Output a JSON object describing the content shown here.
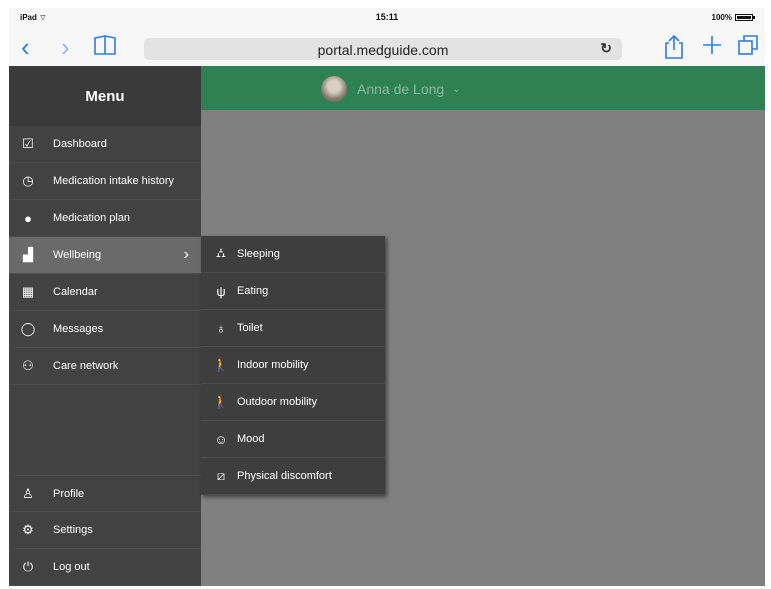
{
  "status_bar": {
    "device": "iPad",
    "time": "15:11",
    "battery": "100%"
  },
  "browser": {
    "url": "portal.medguide.com",
    "icons": [
      "back-icon",
      "forward-icon",
      "bookmarks-icon",
      "reload-icon",
      "share-icon",
      "add-tab-icon",
      "tabs-icon"
    ]
  },
  "header": {
    "user_name": "Anna de Long"
  },
  "sidebar": {
    "title": "Menu",
    "items": [
      {
        "label": "Dashboard",
        "icon": "dashboard-icon"
      },
      {
        "label": "Medication intake history",
        "icon": "history-icon"
      },
      {
        "label": "Medication plan",
        "icon": "pills-icon"
      },
      {
        "label": "Wellbeing",
        "icon": "chart-icon",
        "active": true
      },
      {
        "label": "Calendar",
        "icon": "calendar-icon"
      },
      {
        "label": "Messages",
        "icon": "chat-icon"
      },
      {
        "label": "Care network",
        "icon": "people-icon"
      }
    ],
    "bottom_items": [
      {
        "label": "Profile",
        "icon": "user-icon"
      },
      {
        "label": "Settings",
        "icon": "gear-icon"
      },
      {
        "label": "Log out",
        "icon": "logout-icon"
      }
    ]
  },
  "wellbeing_submenu": [
    {
      "label": "Sleeping",
      "icon": "bed-icon"
    },
    {
      "label": "Eating",
      "icon": "cutlery-icon"
    },
    {
      "label": "Toilet",
      "icon": "toilet-icon"
    },
    {
      "label": "Indoor mobility",
      "icon": "walking-icon"
    },
    {
      "label": "Outdoor mobility",
      "icon": "walking-icon"
    },
    {
      "label": "Mood",
      "icon": "smiley-icon"
    },
    {
      "label": "Physical discomfort",
      "icon": "bandage-icon"
    }
  ],
  "colors": {
    "brand_green": "#2e8152",
    "sidebar": "#424242",
    "active": "#6a6a6a",
    "ios_blue": "#2f7de1"
  }
}
